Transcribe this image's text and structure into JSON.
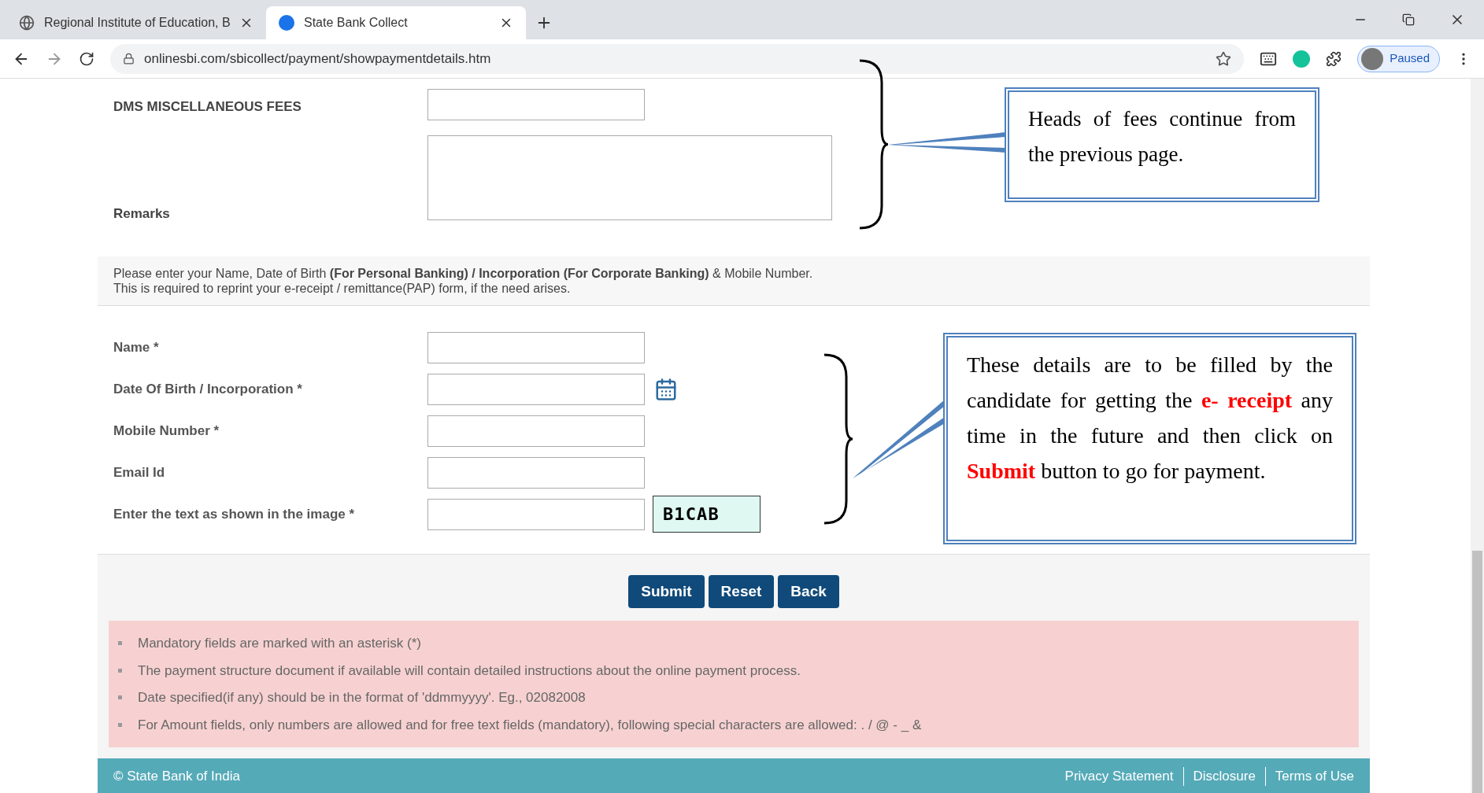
{
  "browser": {
    "tabs": [
      {
        "title": "Regional Institute of Education, B",
        "selected": false
      },
      {
        "title": "State Bank Collect",
        "selected": true
      }
    ],
    "url": "onlinesbi.com/sbicollect/payment/showpaymentdetails.htm",
    "profile": "Paused"
  },
  "fees": [
    {
      "label": "DMS MISCELLANEOUS FEES"
    }
  ],
  "remarks": {
    "label": "Remarks"
  },
  "info": [
    "Please enter your Name, Date of Birth **(For Personal Banking) / Incorporation (For Corporate Banking)**  & Mobile Number.",
    "This is required to reprint your e-receipt / remittance(PAP) form, if the need arises."
  ],
  "fields": [
    {
      "label": "Name *",
      "kind": "text"
    },
    {
      "label": "Date Of Birth / Incorporation *",
      "kind": "date"
    },
    {
      "label": "Mobile Number *",
      "kind": "text"
    },
    {
      "label": "Email Id",
      "kind": "text"
    },
    {
      "label": "Enter the text as shown in the image *",
      "kind": "captcha",
      "captcha": "B1CAB"
    }
  ],
  "buttons": [
    "Submit",
    "Reset",
    "Back"
  ],
  "notes": [
    "Mandatory fields are marked with an asterisk (*)",
    "The payment structure document if available will contain detailed instructions about the online payment process.",
    "Date specified(if any) should be in the format of 'ddmmyyyy'. Eg., 02082008",
    "For Amount fields, only numbers are allowed and for free text fields (mandatory), following special characters are allowed: . / @ - _ &"
  ],
  "footer": {
    "copyright": "© State Bank of India",
    "links": [
      "Privacy Statement",
      "Disclosure",
      "Terms of Use"
    ]
  },
  "callouts": [
    {
      "text": "Heads of fees continue from the previous page."
    },
    {
      "text": "These details are to be filled by the candidate for getting the **e- receipt** any time in the future and then click on **Submit** button to go for payment."
    }
  ]
}
